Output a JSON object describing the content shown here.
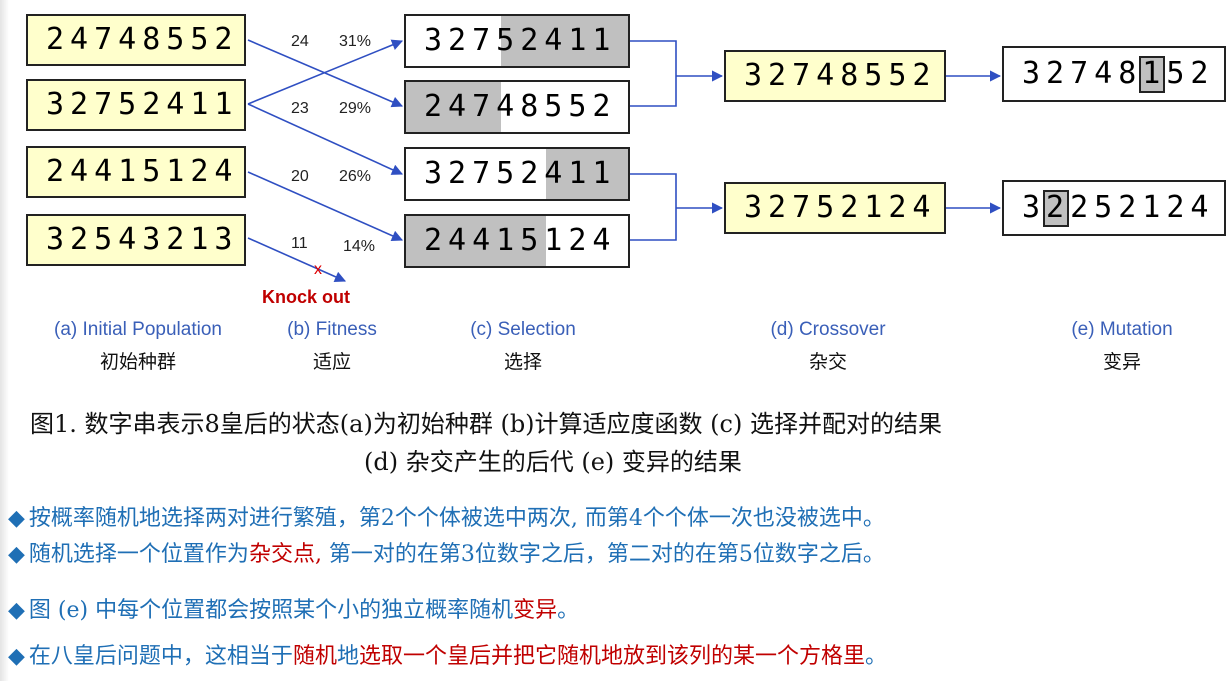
{
  "initial": [
    "24748552",
    "32752411",
    "24415124",
    "32543213"
  ],
  "fitness": [
    {
      "score": "24",
      "pct": "31%"
    },
    {
      "score": "23",
      "pct": "29%"
    },
    {
      "score": "20",
      "pct": "26%"
    },
    {
      "score": "11",
      "pct": "14%"
    }
  ],
  "knock_out": "Knock out",
  "x_mark": "x",
  "selection": [
    "32752411",
    "24748552",
    "32752411",
    "24415124"
  ],
  "crossover": [
    "32748552",
    "32752124"
  ],
  "mutation": [
    "32748152",
    "32252124"
  ],
  "labels": {
    "a": "(a) Initial Population",
    "a_cn": "初始种群",
    "b": "(b) Fitness",
    "b_cn": "适应",
    "c": "(c) Selection",
    "c_cn": "选择",
    "d": "(d) Crossover",
    "d_cn": "杂交",
    "e": "(e) Mutation",
    "e_cn": "变异"
  },
  "caption": {
    "line1": "图1. 数字串表示8皇后的状态(a)为初始种群   (b)计算适应度函数  (c) 选择并配对的结果",
    "line2": "(d) 杂交产生的后代     (e) 变异的结果"
  },
  "bullets": {
    "b1": "按概率随机地选择两对进行繁殖，第2个个体被选中两次, 而第4个个体一次也没被选中。",
    "b2_pre": "随机选择一个位置作为",
    "b2_red": "杂交点,",
    "b2_post": " 第一对的在第3位数字之后，第二对的在第5位数字之后。",
    "b3_pre": "图 (e) 中每个位置都会按照某个小的独立概率随机",
    "b3_red": "变异",
    "b3_post": "。",
    "b4_pre": "在八皇后问题中，这相当于",
    "b4_red1": "随机",
    "b4_mid": "地",
    "b4_red2": "选取一个皇后并把它随机地放到该列的某一个方格里",
    "b4_post": "。"
  },
  "colors": {
    "yellow_box": "#ffffcc",
    "shade": "#c0c0c0",
    "arrow": "#2f4fc2",
    "label_blue": "#3a5fb8",
    "bullet_blue": "#1f6fb5",
    "red": "#c00000"
  }
}
